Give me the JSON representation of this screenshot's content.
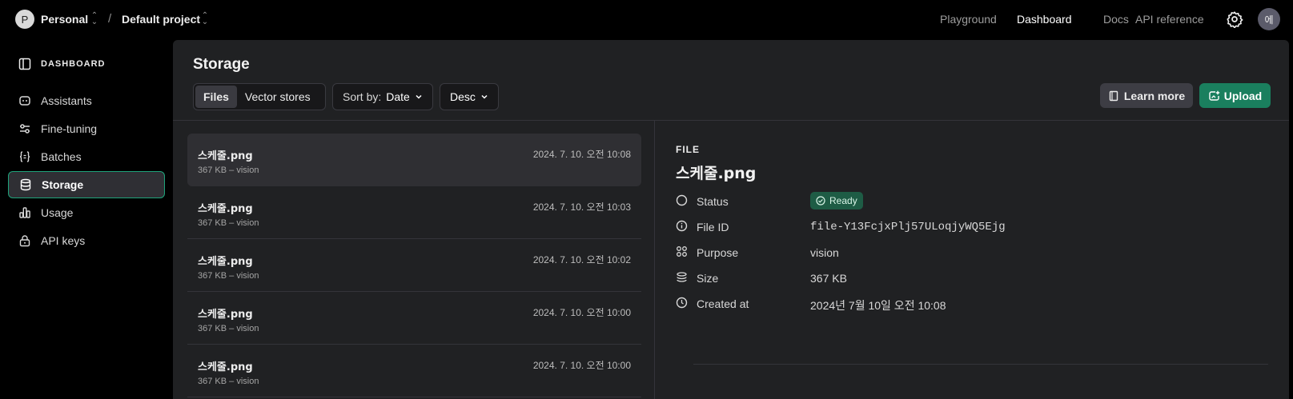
{
  "topbar": {
    "org_initial": "P",
    "org_name": "Personal",
    "separator": "/",
    "project_name": "Default project",
    "nav": [
      "Playground",
      "Dashboard",
      "Docs",
      "API reference"
    ],
    "active_nav": "Dashboard",
    "user_initial": "에"
  },
  "sidebar": {
    "header": "DASHBOARD",
    "items": [
      {
        "label": "Assistants",
        "icon": "robot-icon"
      },
      {
        "label": "Fine-tuning",
        "icon": "sliders-icon"
      },
      {
        "label": "Batches",
        "icon": "braces-icon"
      },
      {
        "label": "Storage",
        "icon": "database-icon"
      },
      {
        "label": "Usage",
        "icon": "bar-chart-icon"
      },
      {
        "label": "API keys",
        "icon": "lock-icon"
      }
    ],
    "active": "Storage"
  },
  "main": {
    "title": "Storage",
    "tabs": [
      "Files",
      "Vector stores"
    ],
    "active_tab": "Files",
    "sort_prefix": "Sort by:",
    "sort_value": "Date",
    "order_value": "Desc",
    "learn_more_label": "Learn more",
    "upload_label": "Upload"
  },
  "files": [
    {
      "name": "스케줄.png",
      "meta": "367 KB – vision",
      "date": "2024. 7. 10. 오전 10:08"
    },
    {
      "name": "스케줄.png",
      "meta": "367 KB – vision",
      "date": "2024. 7. 10. 오전 10:03"
    },
    {
      "name": "스케줄.png",
      "meta": "367 KB – vision",
      "date": "2024. 7. 10. 오전 10:02"
    },
    {
      "name": "스케줄.png",
      "meta": "367 KB – vision",
      "date": "2024. 7. 10. 오전 10:00"
    },
    {
      "name": "스케줄.png",
      "meta": "367 KB – vision",
      "date": "2024. 7. 10. 오전 10:00"
    }
  ],
  "detail": {
    "kicker": "FILE",
    "title": "스케줄.png",
    "status_label": "Status",
    "status_value": "Ready",
    "file_id_label": "File ID",
    "file_id_value": "file-Y13FcjxPlj57ULoqjyWQ5Ejg",
    "purpose_label": "Purpose",
    "purpose_value": "vision",
    "size_label": "Size",
    "size_value": "367 KB",
    "created_label": "Created at",
    "created_value": "2024년 7월 10일 오전 10:08"
  },
  "colors": {
    "accent": "#1a7f5e",
    "active_border": "#1ea37a",
    "panel_bg": "#202123",
    "ready_badge": "#1e5c45"
  }
}
